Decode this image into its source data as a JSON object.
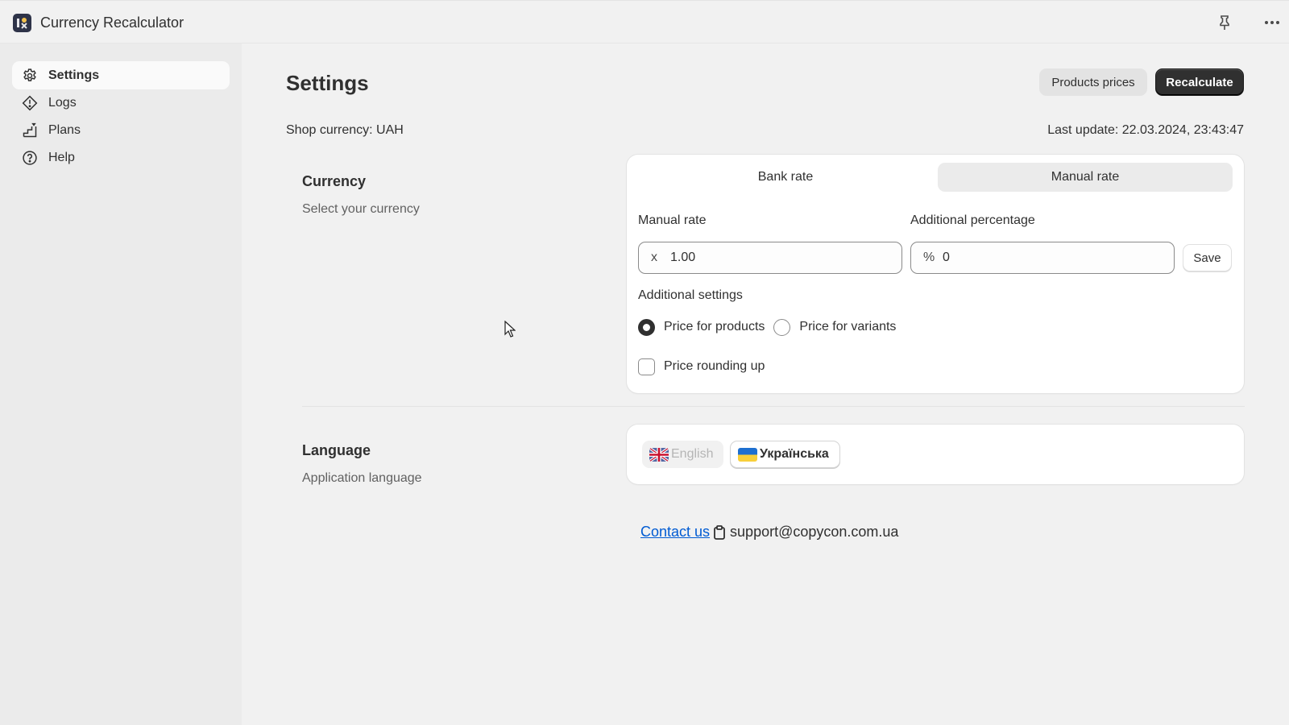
{
  "app": {
    "title": "Currency Recalculator",
    "logo_icon": "app-logo-icon"
  },
  "titlebar": {
    "pin_icon": "pin-icon",
    "more_icon": "more-horizontal-icon"
  },
  "sidebar": {
    "items": [
      {
        "label": "Settings",
        "icon": "gear-icon",
        "active": true
      },
      {
        "label": "Logs",
        "icon": "alert-diamond-icon",
        "active": false
      },
      {
        "label": "Plans",
        "icon": "stairs-icon",
        "active": false
      },
      {
        "label": "Help",
        "icon": "question-circle-icon",
        "active": false
      }
    ]
  },
  "header": {
    "page_title": "Settings",
    "products_prices_label": "Products prices",
    "recalculate_label": "Recalculate",
    "shop_currency": "Shop currency: UAH",
    "last_update": "Last update: 22.03.2024, 23:43:47"
  },
  "currency_section": {
    "title": "Currency",
    "subtitle": "Select your currency",
    "tabs": [
      {
        "label": "Bank rate",
        "active": false
      },
      {
        "label": "Manual rate",
        "active": true
      }
    ],
    "manual_rate": {
      "label": "Manual rate",
      "prefix": "x",
      "value": "1.00"
    },
    "additional_percentage": {
      "label": "Additional percentage",
      "prefix": "%",
      "value": "0"
    },
    "save_label": "Save",
    "additional_settings_label": "Additional settings",
    "price_target_options": [
      {
        "label": "Price for products",
        "checked": true
      },
      {
        "label": "Price for variants",
        "checked": false
      }
    ],
    "rounding": {
      "label": "Price rounding up",
      "checked": false
    }
  },
  "language_section": {
    "title": "Language",
    "subtitle": "Application language",
    "options": [
      {
        "label": "English",
        "flag": "uk-flag-icon",
        "selected": false
      },
      {
        "label": "Українська",
        "flag": "ukraine-flag-icon",
        "selected": true
      }
    ]
  },
  "footer": {
    "contact_label": "Contact us",
    "clipboard_icon": "clipboard-icon",
    "email": "support@copycon.com.ua"
  },
  "colors": {
    "primary_button": "#303030",
    "link": "#005bd3",
    "page_bg": "#f1f1f1",
    "sidebar_bg": "#ebebeb"
  }
}
